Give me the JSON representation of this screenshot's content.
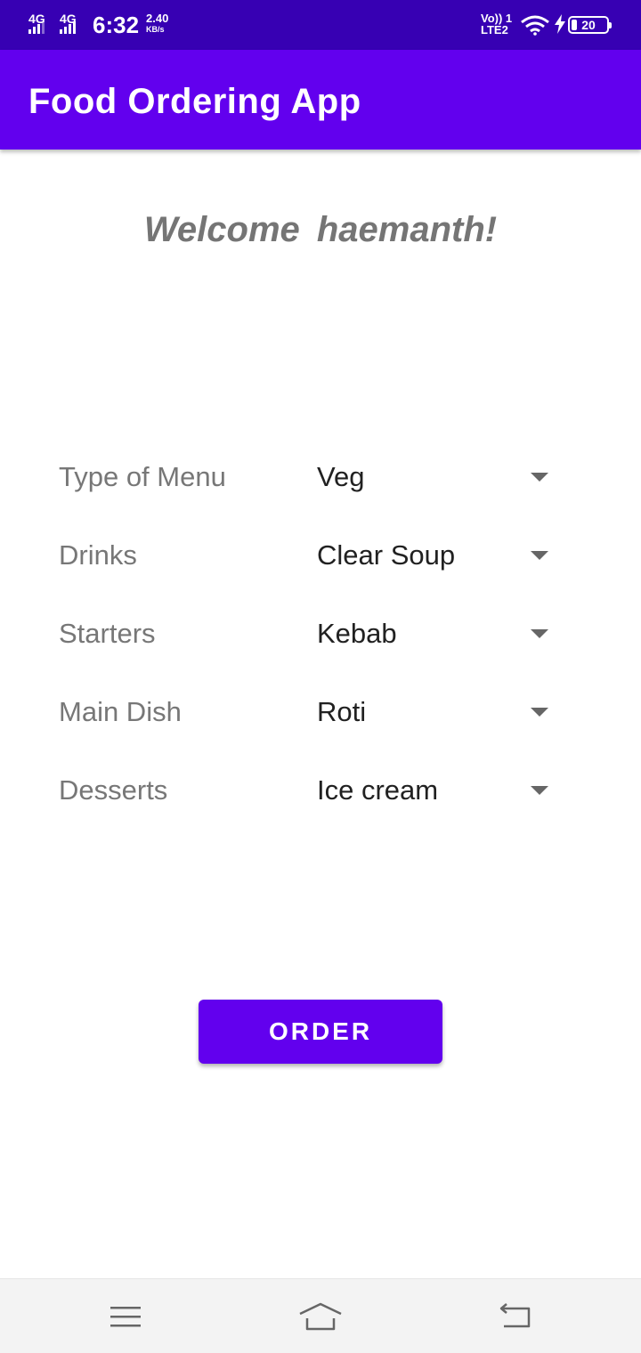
{
  "status_bar": {
    "network_1": "4G",
    "network_2": "4G",
    "time": "6:32",
    "speed_value": "2.40",
    "speed_unit": "KB/s",
    "volte_line1": "Vo)) 1",
    "volte_line2": "LTE2",
    "battery": "20",
    "icons": [
      "signal-icon",
      "wifi-icon",
      "charging-bolt-icon",
      "battery-icon"
    ]
  },
  "app_bar": {
    "title": "Food Ordering App"
  },
  "welcome": {
    "text": "Welcome  haemanth!"
  },
  "form": {
    "rows": [
      {
        "label": "Type of Menu",
        "value": "Veg"
      },
      {
        "label": "Drinks",
        "value": "Clear Soup"
      },
      {
        "label": "Starters",
        "value": "Kebab"
      },
      {
        "label": "Main Dish",
        "value": "Roti"
      },
      {
        "label": "Desserts",
        "value": "Ice cream"
      }
    ]
  },
  "order_button": {
    "label": "ORDER"
  },
  "nav_bar": {
    "icons": [
      "menu-icon",
      "home-icon",
      "back-icon"
    ]
  },
  "colors": {
    "status_bar": "#3700b3",
    "app_bar": "#6200ee",
    "button": "#6200ee",
    "label_text": "#777777",
    "value_text": "#212121"
  }
}
